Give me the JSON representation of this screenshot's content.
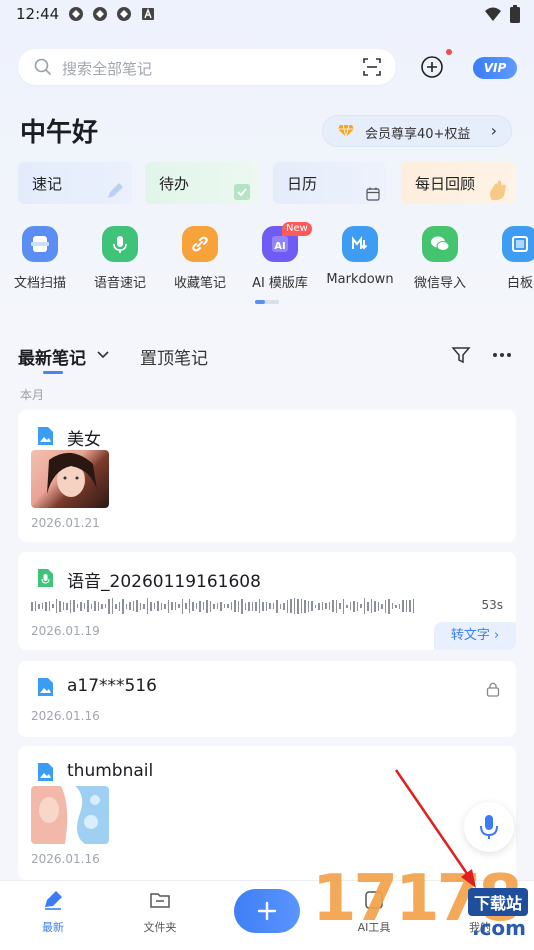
{
  "status_bar": {
    "time": "12:44"
  },
  "search": {
    "placeholder": "搜索全部笔记"
  },
  "header": {
    "vip": "VIP",
    "greeting": "中午好",
    "member_text": "会员尊享40+权益",
    "member_arrow": "›"
  },
  "quick_actions": [
    {
      "label": "速记"
    },
    {
      "label": "待办"
    },
    {
      "label": "日历"
    },
    {
      "label": "每日回顾"
    }
  ],
  "tools": [
    {
      "label": "文档扫描",
      "icon": "scan-doc-icon",
      "color": "#5b8ef3"
    },
    {
      "label": "语音速记",
      "icon": "mic-icon",
      "color": "#3fc27a"
    },
    {
      "label": "收藏笔记",
      "icon": "link-icon",
      "color": "#f7a23b"
    },
    {
      "label": "AI 模版库",
      "icon": "ai-template-icon",
      "color": "#6f5cf5",
      "badge": "New"
    },
    {
      "label": "Markdown",
      "icon": "markdown-icon",
      "color": "#3f9cf3"
    },
    {
      "label": "微信导入",
      "icon": "wechat-icon",
      "color": "#45c46f"
    },
    {
      "label": "白板",
      "icon": "whiteboard-icon",
      "color": "#3f9cf3"
    }
  ],
  "tabs": {
    "active": "最新笔记",
    "other": "置顶笔记"
  },
  "section": {
    "label": "本月"
  },
  "notes": [
    {
      "title": "美女",
      "date": "2026.01.21",
      "type": "image"
    },
    {
      "title": "语音_20260119161608",
      "date": "2026.01.19",
      "type": "audio",
      "duration": "53s",
      "convert": "转文字 ›"
    },
    {
      "title": "a17***516",
      "date": "2026.01.16",
      "type": "image-locked"
    },
    {
      "title": "thumbnail",
      "date": "2026.01.16",
      "type": "image"
    }
  ],
  "bottom_nav": [
    {
      "label": "最新"
    },
    {
      "label": "文件夹"
    },
    {
      "label": "AI工具"
    },
    {
      "label": "我的"
    }
  ],
  "watermark": {
    "digits": "17178",
    "top": "下载站",
    "bottom": ".com"
  },
  "colors": {
    "accent": "#3b7cf6",
    "arrow": "#e02020"
  }
}
